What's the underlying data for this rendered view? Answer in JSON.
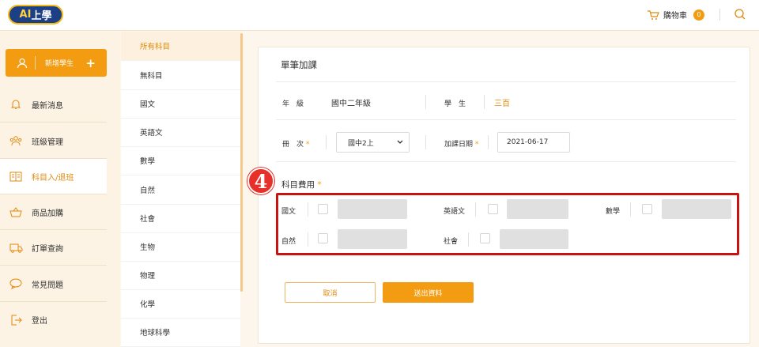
{
  "header": {
    "logo_text_a": "AI",
    "logo_text_b": "上學",
    "cart_label": "購物車",
    "cart_count": "0"
  },
  "sidebar": {
    "add_student": "新增學生",
    "add_plus": "+",
    "items": [
      {
        "label": "最新消息",
        "icon": "bell-icon"
      },
      {
        "label": "班級管理",
        "icon": "users-icon"
      },
      {
        "label": "科目入/退班",
        "icon": "book-icon"
      },
      {
        "label": "商品加購",
        "icon": "basket-icon"
      },
      {
        "label": "訂單查詢",
        "icon": "truck-icon"
      },
      {
        "label": "常見問題",
        "icon": "chat-icon"
      },
      {
        "label": "登出",
        "icon": "logout-icon"
      }
    ]
  },
  "subjects": [
    "所有科目",
    "無科目",
    "國文",
    "英語文",
    "數學",
    "自然",
    "社會",
    "生物",
    "物理",
    "化學",
    "地球科學"
  ],
  "form": {
    "title": "單筆加課",
    "grade_label": "年　級",
    "grade_value": "國中二年級",
    "student_label": "學　生",
    "student_value": "三百",
    "volume_label": "冊　次",
    "volume_value": "國中2上",
    "date_label": "加課日期",
    "date_value": "2021-06-17",
    "fee_label": "科目費用",
    "required_mark": "*",
    "fee_subjects": [
      "國文",
      "英語文",
      "數學",
      "自然",
      "社會"
    ],
    "cancel_label": "取消",
    "submit_label": "送出資料"
  },
  "annotation": {
    "step_number": "4"
  },
  "colors": {
    "accent": "#f39c12",
    "highlight": "#cc1111",
    "marker": "#e8302a"
  }
}
